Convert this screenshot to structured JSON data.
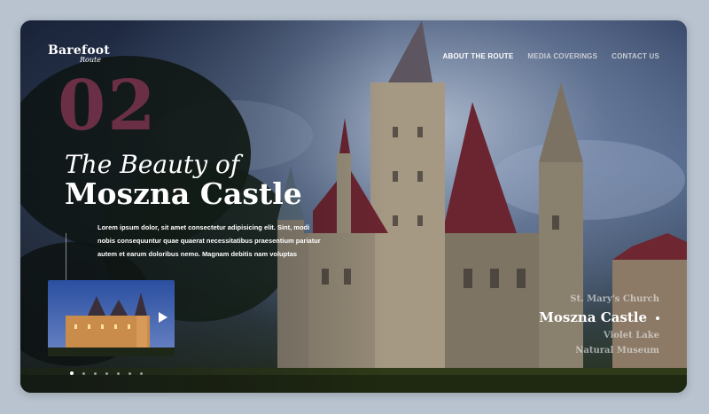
{
  "logo": {
    "main": "Barefoot",
    "sub": "Route"
  },
  "nav": [
    {
      "label": "ABOUT THE ROUTE",
      "active": true
    },
    {
      "label": "MEDIA COVERINGS",
      "active": false
    },
    {
      "label": "CONTACT US",
      "active": false
    }
  ],
  "hero": {
    "number": "02",
    "tagline": "The Beauty of",
    "title": "Moszna Castle",
    "description": "Lorem ipsum dolor, sit amet consectetur adipisicing elit. Sint, modi nobis consequuntur quae quaerat necessitatibus praesentium pariatur autem et earum doloribus nemo. Magnam debitis nam voluptas"
  },
  "video": {
    "icon": "play-icon"
  },
  "carousel": {
    "count": 7,
    "active": 0
  },
  "places": [
    {
      "label": "St. Mary's Church",
      "active": false
    },
    {
      "label": "Moszna Castle",
      "active": true
    },
    {
      "label": "Violet Lake",
      "active": false
    },
    {
      "label": "Natural Museum",
      "active": false
    }
  ],
  "colors": {
    "accent": "#6a2f45",
    "background": "#b8c3cf"
  }
}
